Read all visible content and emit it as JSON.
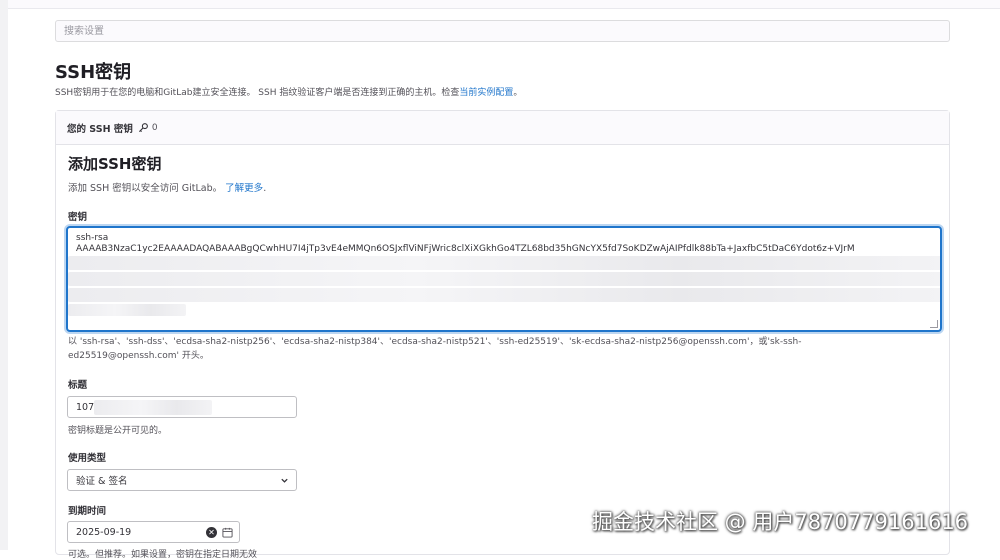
{
  "search": {
    "placeholder": "搜索设置"
  },
  "page": {
    "title": "SSH密钥",
    "desc_text": "SSH密钥用于在您的电脑和GitLab建立安全连接。 SSH 指纹验证客户端是否连接到正确的主机。检查",
    "desc_link": "当前实例配置",
    "desc_end": "。"
  },
  "card": {
    "header": "您的 SSH 密钥",
    "key_icon": "key-icon",
    "count": "0"
  },
  "form": {
    "title": "添加SSH密钥",
    "desc_text": "添加 SSH 密钥以安全访问 GitLab。",
    "desc_link": "了解更多",
    "desc_end": ".",
    "key_label": "密钥",
    "key_line1": "ssh-rsa",
    "key_line2": "AAAAB3NzaC1yc2EAAAADAQABAAABgQCwhHU7I4jTp3vE4eMMQn6OSJxflViNFjWric8clXiXGkhGo4TZL68bd35hGNcYX5fd7SoKDZwAjAIPfdlk88bTa+JaxfbC5tDaC6Ydot6z+VJrM",
    "key_hint_a": "以 'ssh-rsa'、'ssh-dss'、'ecdsa-sha2-nistp256'、'ecdsa-sha2-nistp384'、'ecdsa-sha2-nistp521'、'ssh-ed25519'、'sk-ecdsa-sha2-nistp256@openssh.com'，或'sk-ssh-",
    "key_hint_b": "ed25519@openssh.com' 开头。",
    "title_label": "标题",
    "title_value": "107",
    "title_hint": "密钥标题是公开可见的。",
    "usage_label": "使用类型",
    "usage_value": "验证 & 签名",
    "expiry_label": "到期时间",
    "expiry_value": "2025-09-19",
    "expiry_hint": "可选。但推荐。如果设置，密钥在指定日期无效"
  },
  "watermark": "掘金技术社区 @ 用户7870779161616",
  "colors": {
    "accent": "#1f75cb",
    "focus_ring": "#bcd6f1"
  }
}
